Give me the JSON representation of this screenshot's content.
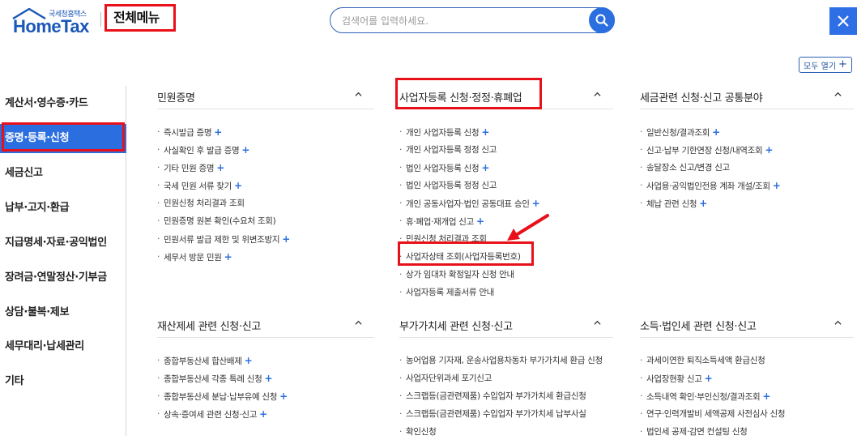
{
  "header": {
    "logo_sub": "국세청홈택스",
    "logo_main": "HomeTax",
    "page_title": "전체메뉴",
    "search_placeholder": "검색어를 입력하세요.",
    "expand_all_label": "모두 열기"
  },
  "sidebar": {
    "items": [
      {
        "label": "계산서·영수증·카드",
        "active": false
      },
      {
        "label": "증명·등록·신청",
        "active": true
      },
      {
        "label": "세금신고",
        "active": false
      },
      {
        "label": "납부·고지·환급",
        "active": false
      },
      {
        "label": "지급명세·자료·공익법인",
        "active": false
      },
      {
        "label": "장려금·연말정산·기부금",
        "active": false
      },
      {
        "label": "상담·불복·제보",
        "active": false
      },
      {
        "label": "세무대리·납세관리",
        "active": false
      },
      {
        "label": "기타",
        "active": false
      }
    ]
  },
  "sections": [
    {
      "title": "민원증명",
      "items": [
        {
          "label": "즉시발급 증명",
          "plus": true
        },
        {
          "label": "사실확인 후 발급 증명",
          "plus": true
        },
        {
          "label": "기타 민원 증명",
          "plus": true
        },
        {
          "label": "국세 민원 서류 찾기",
          "plus": true
        },
        {
          "label": "민원신청 처리결과 조회",
          "plus": false
        },
        {
          "label": "민원증명 원본 확인(수요처 조회)",
          "plus": false
        },
        {
          "label": "민원서류 발급 제한 및 위변조방지",
          "plus": true
        },
        {
          "label": "세무서 방문 민원",
          "plus": true
        }
      ]
    },
    {
      "title": "사업자등록 신청·정정·휴폐업",
      "items": [
        {
          "label": "개인 사업자등록 신청",
          "plus": true
        },
        {
          "label": "개인 사업자등록 정정 신고",
          "plus": false
        },
        {
          "label": "법인 사업자등록 신청",
          "plus": true
        },
        {
          "label": "법인 사업자등록 정정 신고",
          "plus": false
        },
        {
          "label": "개인 공동사업자·법인 공동대표 승인",
          "plus": true
        },
        {
          "label": "휴·폐업·재개업 신고",
          "plus": true
        },
        {
          "label": "민원신청 처리결과 조회",
          "plus": false
        },
        {
          "label": "사업자상태 조회(사업자등록번호)",
          "plus": false
        },
        {
          "label": "상가 임대차 확정일자 신청 안내",
          "plus": false
        },
        {
          "label": "사업자등록 제출서류 안내",
          "plus": false
        }
      ]
    },
    {
      "title": "세금관련 신청·신고 공통분야",
      "items": [
        {
          "label": "일반신청/결과조회",
          "plus": true
        },
        {
          "label": "신고·납부 기한연장 신청/내역조회",
          "plus": true
        },
        {
          "label": "송달장소 신고/변경 신고",
          "plus": false
        },
        {
          "label": "사업용·공익법인전용 계좌 개설/조회",
          "plus": true
        },
        {
          "label": "체납 관련 신청",
          "plus": true
        }
      ]
    },
    {
      "title": "재산제세 관련 신청·신고",
      "items": [
        {
          "label": "종합부동산세 합산배제",
          "plus": true
        },
        {
          "label": "종합부동산세 각종 특례 신청",
          "plus": true
        },
        {
          "label": "종합부동산세 분납·납부유예 신청",
          "plus": true
        },
        {
          "label": "상속·증여세 관련 신청·신고",
          "plus": true
        }
      ]
    },
    {
      "title": "부가가치세 관련 신청·신고",
      "items": [
        {
          "label": "농어업용 기자재, 운송사업용차동차 부가가치세 환급 신청",
          "plus": false
        },
        {
          "label": "사업자단위과세 포기신고",
          "plus": false
        },
        {
          "label": "스크랩등(금관련제품) 수입업자 부가가치세 환급신청",
          "plus": false
        },
        {
          "label": "스크랩등(금관련제품) 수입업자 부가가치세 납부사실",
          "plus": false
        },
        {
          "label": "확인신청",
          "plus": false
        }
      ]
    },
    {
      "title": "소득·법인세 관련 신청·신고",
      "items": [
        {
          "label": "과세이연한 퇴직소득세액 환급신청",
          "plus": false
        },
        {
          "label": "사업장현황 신고",
          "plus": true
        },
        {
          "label": "소득내역 확인·부인신청/결과조회",
          "plus": true
        },
        {
          "label": "연구·인력개발비 세액공제 사전심사 신청",
          "plus": false
        },
        {
          "label": "법인세 공제·감면 컨설팅 신청",
          "plus": false
        }
      ]
    }
  ],
  "colors": {
    "accent": "#2b6ee0",
    "highlight": "#e8111a",
    "brand": "#1a57b8"
  }
}
